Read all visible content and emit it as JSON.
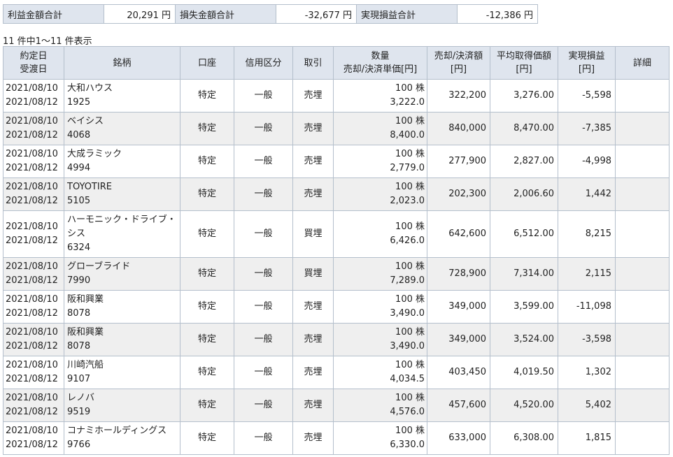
{
  "summary": {
    "profit_label": "利益金額合計",
    "profit_value": "20,291 円",
    "loss_label": "損失金額合計",
    "loss_value": "-32,677 円",
    "realized_label": "実現損益合計",
    "realized_value": "-12,386 円"
  },
  "count_text": "11 件中1～11 件表示",
  "headers": {
    "date": [
      "約定日",
      "受渡日"
    ],
    "name": "銘柄",
    "account": "口座",
    "credit": "信用区分",
    "trade": "取引",
    "qty": [
      "数量",
      "売却/決済単価[円]"
    ],
    "amount": [
      "売却/決済額",
      "[円]"
    ],
    "avg": [
      "平均取得価額",
      "[円]"
    ],
    "pl": [
      "実現損益",
      "[円]"
    ],
    "detail": "詳細"
  },
  "rows": [
    {
      "trade_date": "2021/08/10",
      "settle_date": "2021/08/12",
      "name": "大和ハウス",
      "code": "1925",
      "account": "特定",
      "credit": "一般",
      "trade": "売埋",
      "qty": "100 株",
      "price": "3,222.0",
      "amount": "322,200",
      "avg": "3,276.00",
      "pl": "-5,598"
    },
    {
      "trade_date": "2021/08/10",
      "settle_date": "2021/08/12",
      "name": "ベイシス",
      "code": "4068",
      "account": "特定",
      "credit": "一般",
      "trade": "売埋",
      "qty": "100 株",
      "price": "8,400.0",
      "amount": "840,000",
      "avg": "8,470.00",
      "pl": "-7,385"
    },
    {
      "trade_date": "2021/08/10",
      "settle_date": "2021/08/12",
      "name": "大成ラミック",
      "code": "4994",
      "account": "特定",
      "credit": "一般",
      "trade": "売埋",
      "qty": "100 株",
      "price": "2,779.0",
      "amount": "277,900",
      "avg": "2,827.00",
      "pl": "-4,998"
    },
    {
      "trade_date": "2021/08/10",
      "settle_date": "2021/08/12",
      "name": "TOYOTIRE",
      "code": "5105",
      "account": "特定",
      "credit": "一般",
      "trade": "売埋",
      "qty": "100 株",
      "price": "2,023.0",
      "amount": "202,300",
      "avg": "2,006.60",
      "pl": "1,442"
    },
    {
      "trade_date": "2021/08/10",
      "settle_date": "2021/08/12",
      "name": "ハーモニック・ドライブ・シス",
      "code": "6324",
      "account": "特定",
      "credit": "一般",
      "trade": "買埋",
      "qty": "100 株",
      "price": "6,426.0",
      "amount": "642,600",
      "avg": "6,512.00",
      "pl": "8,215"
    },
    {
      "trade_date": "2021/08/10",
      "settle_date": "2021/08/12",
      "name": "グローブライド",
      "code": "7990",
      "account": "特定",
      "credit": "一般",
      "trade": "買埋",
      "qty": "100 株",
      "price": "7,289.0",
      "amount": "728,900",
      "avg": "7,314.00",
      "pl": "2,115"
    },
    {
      "trade_date": "2021/08/10",
      "settle_date": "2021/08/12",
      "name": "阪和興業",
      "code": "8078",
      "account": "特定",
      "credit": "一般",
      "trade": "売埋",
      "qty": "100 株",
      "price": "3,490.0",
      "amount": "349,000",
      "avg": "3,599.00",
      "pl": "-11,098"
    },
    {
      "trade_date": "2021/08/10",
      "settle_date": "2021/08/12",
      "name": "阪和興業",
      "code": "8078",
      "account": "特定",
      "credit": "一般",
      "trade": "売埋",
      "qty": "100 株",
      "price": "3,490.0",
      "amount": "349,000",
      "avg": "3,524.00",
      "pl": "-3,598"
    },
    {
      "trade_date": "2021/08/10",
      "settle_date": "2021/08/12",
      "name": "川崎汽船",
      "code": "9107",
      "account": "特定",
      "credit": "一般",
      "trade": "売埋",
      "qty": "100 株",
      "price": "4,034.5",
      "amount": "403,450",
      "avg": "4,019.50",
      "pl": "1,302"
    },
    {
      "trade_date": "2021/08/10",
      "settle_date": "2021/08/12",
      "name": "レノバ",
      "code": "9519",
      "account": "特定",
      "credit": "一般",
      "trade": "売埋",
      "qty": "100 株",
      "price": "4,576.0",
      "amount": "457,600",
      "avg": "4,520.00",
      "pl": "5,402"
    },
    {
      "trade_date": "2021/08/10",
      "settle_date": "2021/08/12",
      "name": "コナミホールディングス",
      "code": "9766",
      "account": "特定",
      "credit": "一般",
      "trade": "売埋",
      "qty": "100 株",
      "price": "6,330.0",
      "amount": "633,000",
      "avg": "6,308.00",
      "pl": "1,815"
    }
  ]
}
